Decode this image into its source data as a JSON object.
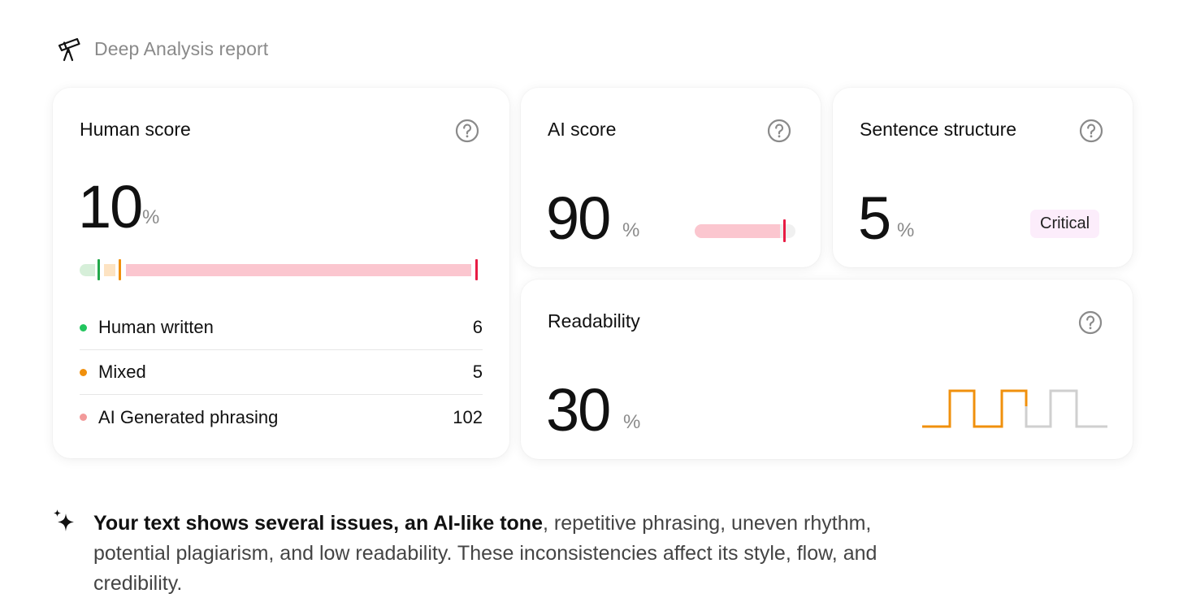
{
  "header": {
    "title": "Deep Analysis report",
    "icon": "telescope-icon"
  },
  "human_score": {
    "title": "Human score",
    "value": "10",
    "unit": "%",
    "bar_colors": {
      "human": "#22a84a",
      "mixed": "#f0900d",
      "ai": "#e81c44"
    },
    "legend": [
      {
        "label": "Human written",
        "count": "6",
        "color": "#22c55e"
      },
      {
        "label": "Mixed",
        "count": "5",
        "color": "#f0900d"
      },
      {
        "label": "AI Generated phrasing",
        "count": "102",
        "color": "#f29a9a"
      }
    ]
  },
  "ai_score": {
    "title": "AI score",
    "value": "90",
    "unit": "%",
    "progress": 0.9
  },
  "sentence_structure": {
    "title": "Sentence structure",
    "value": "5",
    "unit": "%",
    "badge": "Critical"
  },
  "readability": {
    "title": "Readability",
    "value": "30",
    "unit": "%"
  },
  "summary": {
    "bold_text": "Your text shows several issues, an AI-like tone",
    "rest_text": ", repetitive phrasing, uneven rhythm, potential plagiarism, and low readability. These inconsistencies affect its style, flow, and credibility."
  },
  "colors": {
    "accent_orange": "#f0900d",
    "accent_red": "#e81c44",
    "muted_gray": "#8a8a8a",
    "badge_bg": "#fcedfb"
  }
}
